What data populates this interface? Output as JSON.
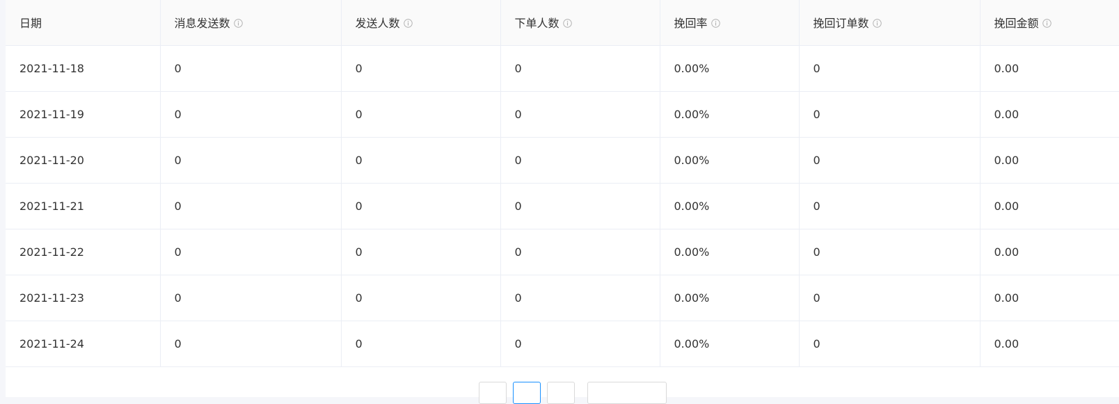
{
  "table": {
    "columns": [
      {
        "label": "日期",
        "info_icon": false
      },
      {
        "label": "消息发送数",
        "info_icon": true
      },
      {
        "label": "发送人数",
        "info_icon": true
      },
      {
        "label": "下单人数",
        "info_icon": true
      },
      {
        "label": "挽回率",
        "info_icon": true
      },
      {
        "label": "挽回订单数",
        "info_icon": true
      },
      {
        "label": "挽回金额",
        "info_icon": true
      }
    ],
    "rows": [
      [
        "2021-11-18",
        "0",
        "0",
        "0",
        "0.00%",
        "0",
        "0.00"
      ],
      [
        "2021-11-19",
        "0",
        "0",
        "0",
        "0.00%",
        "0",
        "0.00"
      ],
      [
        "2021-11-20",
        "0",
        "0",
        "0",
        "0.00%",
        "0",
        "0.00"
      ],
      [
        "2021-11-21",
        "0",
        "0",
        "0",
        "0.00%",
        "0",
        "0.00"
      ],
      [
        "2021-11-22",
        "0",
        "0",
        "0",
        "0.00%",
        "0",
        "0.00"
      ],
      [
        "2021-11-23",
        "0",
        "0",
        "0",
        "0.00%",
        "0",
        "0.00"
      ],
      [
        "2021-11-24",
        "0",
        "0",
        "0",
        "0.00%",
        "0",
        "0.00"
      ]
    ]
  },
  "icons": {
    "header_info": "info-circle-icon"
  },
  "colors": {
    "header_bg": "#fafafa",
    "border": "#ebeef5",
    "text": "#333333",
    "icon": "#b0b0b0",
    "page_bg": "#f5f6fa",
    "pager_active": "#1890ff"
  }
}
